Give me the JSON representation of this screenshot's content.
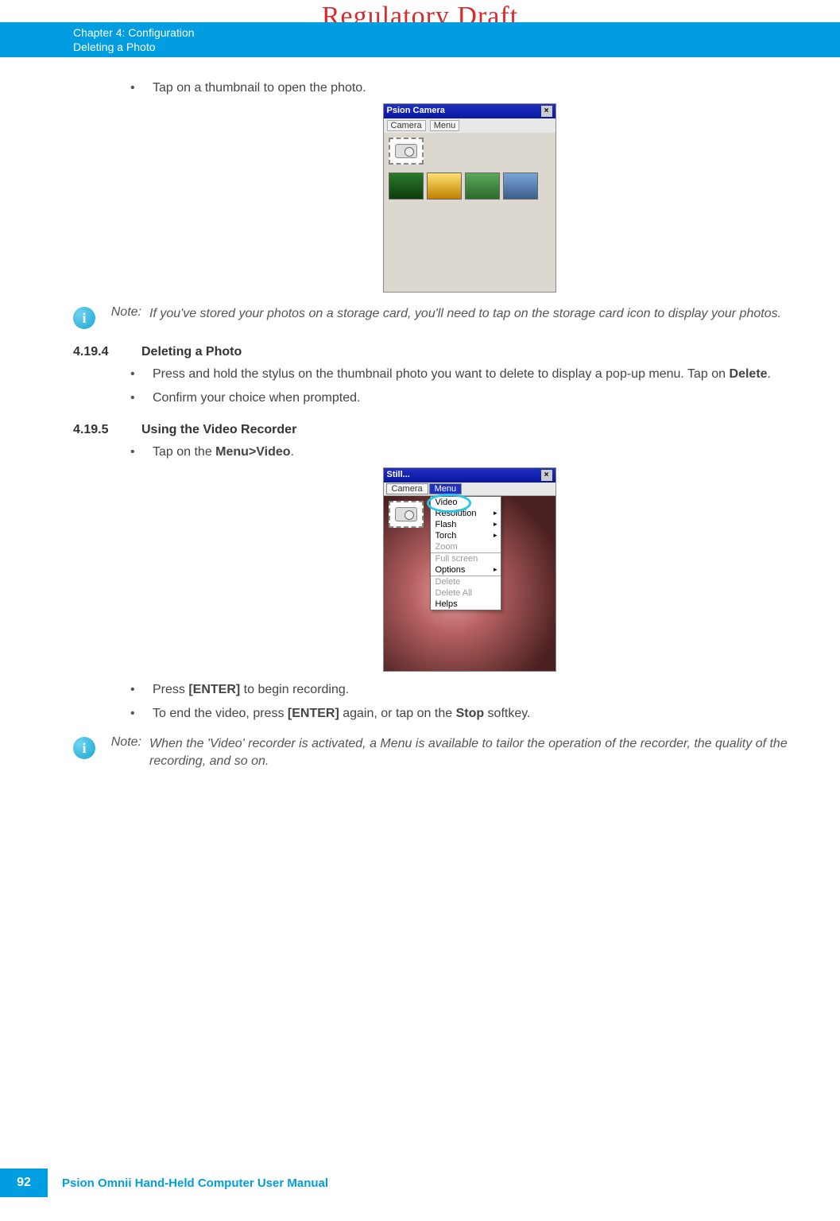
{
  "watermark": "Regulatory Draft",
  "header": {
    "chapter": "Chapter 4:  Configuration",
    "subtitle": "Deleting a Photo"
  },
  "intro_bullet": "Tap on a thumbnail to open the photo.",
  "ss1": {
    "title": "Psion Camera",
    "close": "×",
    "menu_camera": "Camera",
    "menu_menu": "Menu"
  },
  "note1": {
    "label": "Note:",
    "text": "If you've stored your photos on a storage card, you'll need to tap on the storage card icon to display your photos."
  },
  "sec1": {
    "num": "4.19.4",
    "title": "Deleting a Photo"
  },
  "sec1_b1a": "Press and hold the stylus on the thumbnail photo you want to delete to display a pop-up menu. Tap on ",
  "sec1_b1b": "Delete",
  "sec1_b1c": ".",
  "sec1_b2": "Confirm your choice when prompted.",
  "sec2": {
    "num": "4.19.5",
    "title": "Using the Video Recorder"
  },
  "sec2_b1a": "Tap on the ",
  "sec2_b1b": "Menu>Video",
  "sec2_b1c": ".",
  "ss2": {
    "title": "Still...",
    "close": "×",
    "tab_camera": "Camera",
    "tab_menu": "Menu",
    "items": {
      "video": "Video",
      "resolution": "Resolution",
      "flash": "Flash",
      "torch": "Torch",
      "zoom": "Zoom",
      "fullscreen": "Full screen",
      "options": "Options",
      "delete": "Delete",
      "delete_all": "Delete All",
      "helps": "Helps"
    }
  },
  "sec2_b2a": "Press ",
  "sec2_b2b": "[ENTER]",
  "sec2_b2c": " to begin recording.",
  "sec2_b3a": "To end the video, press ",
  "sec2_b3b": "[ENTER]",
  "sec2_b3c": " again, or tap on the ",
  "sec2_b3d": "Stop",
  "sec2_b3e": " softkey.",
  "note2": {
    "label": "Note:",
    "text": "When the 'Video' recorder is activated, a Menu is available to tailor the operation of the recorder, the quality of the recording, and so on."
  },
  "footer": {
    "page": "92",
    "text": "Psion Omnii Hand-Held Computer User Manual"
  }
}
